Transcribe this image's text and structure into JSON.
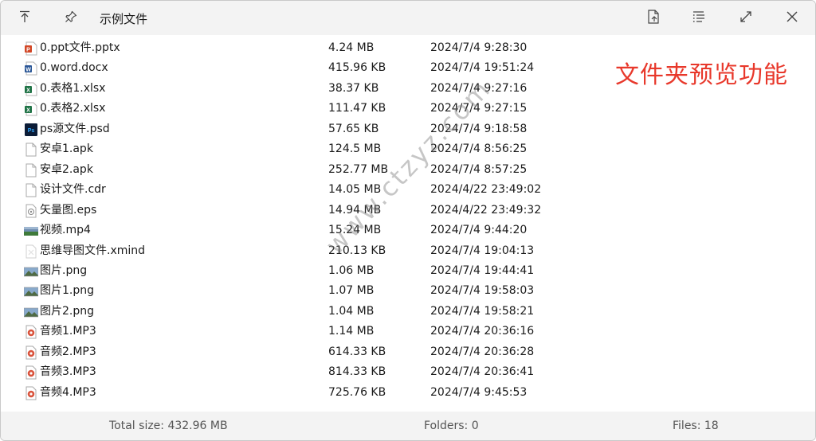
{
  "window": {
    "title": "示例文件"
  },
  "titlebar": {
    "buttons": [
      {
        "icon": "pin-top-icon"
      },
      {
        "icon": "pin-icon"
      },
      {
        "icon": "open-file-icon"
      },
      {
        "icon": "list-view-icon"
      },
      {
        "icon": "maximize-icon"
      },
      {
        "icon": "close-icon"
      }
    ]
  },
  "overlay_text": "文件夹预览功能",
  "watermark": "www.ctzyz.com",
  "files": [
    {
      "name": "0.ppt文件.pptx",
      "size": "4.24 MB",
      "date": "2024/7/4 9:28:30",
      "icon": "powerpoint-icon"
    },
    {
      "name": "0.word.docx",
      "size": "415.96 KB",
      "date": "2024/7/4 19:51:24",
      "icon": "word-icon"
    },
    {
      "name": "0.表格1.xlsx",
      "size": "38.37 KB",
      "date": "2024/7/4 9:27:16",
      "icon": "excel-icon"
    },
    {
      "name": "0.表格2.xlsx",
      "size": "111.47 KB",
      "date": "2024/7/4 9:27:15",
      "icon": "excel-icon"
    },
    {
      "name": "ps源文件.psd",
      "size": "57.65 KB",
      "date": "2024/7/4 9:18:58",
      "icon": "photoshop-icon"
    },
    {
      "name": "安卓1.apk",
      "size": "124.5 MB",
      "date": "2024/7/4 8:56:25",
      "icon": "blank-file-icon"
    },
    {
      "name": "安卓2.apk",
      "size": "252.77 MB",
      "date": "2024/7/4 8:57:25",
      "icon": "blank-file-icon"
    },
    {
      "name": "设计文件.cdr",
      "size": "14.05 MB",
      "date": "2024/4/22 23:49:02",
      "icon": "blank-file-icon"
    },
    {
      "name": "矢量图.eps",
      "size": "14.94 MB",
      "date": "2024/4/22 23:49:32",
      "icon": "eps-file-icon"
    },
    {
      "name": "视频.mp4",
      "size": "15.24 MB",
      "date": "2024/7/4 9:44:20",
      "icon": "video-thumbnail-icon"
    },
    {
      "name": "思维导图文件.xmind",
      "size": "210.13 KB",
      "date": "2024/7/4 19:04:13",
      "icon": "xmind-icon"
    },
    {
      "name": "图片.png",
      "size": "1.06 MB",
      "date": "2024/7/4 19:44:41",
      "icon": "image-thumbnail-icon"
    },
    {
      "name": "图片1.png",
      "size": "1.07 MB",
      "date": "2024/7/4 19:58:03",
      "icon": "image-thumbnail-icon"
    },
    {
      "name": "图片2.png",
      "size": "1.04 MB",
      "date": "2024/7/4 19:58:21",
      "icon": "image-thumbnail-icon"
    },
    {
      "name": "音频1.MP3",
      "size": "1.14 MB",
      "date": "2024/7/4 20:36:16",
      "icon": "audio-file-icon"
    },
    {
      "name": "音频2.MP3",
      "size": "614.33 KB",
      "date": "2024/7/4 20:36:28",
      "icon": "audio-file-icon"
    },
    {
      "name": "音频3.MP3",
      "size": "814.33 KB",
      "date": "2024/7/4 20:36:41",
      "icon": "audio-file-icon"
    },
    {
      "name": "音频4.MP3",
      "size": "725.76 KB",
      "date": "2024/7/4 9:45:53",
      "icon": "audio-file-icon"
    }
  ],
  "status": {
    "total_size": "Total size: 432.96 MB",
    "folders": "Folders: 0",
    "files": "Files: 18"
  },
  "colors": {
    "overlay_red": "#e8382b",
    "titlebar_bg": "#f3f3f3"
  }
}
